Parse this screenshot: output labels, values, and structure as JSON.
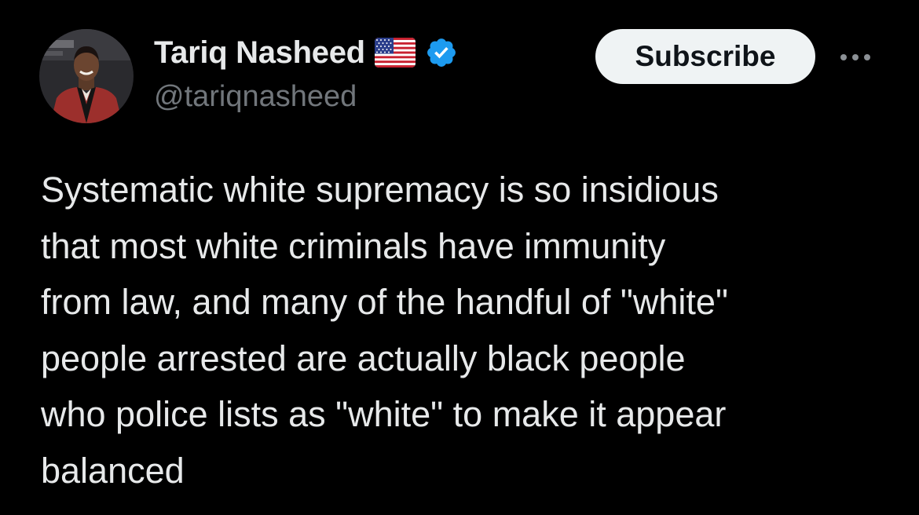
{
  "author": {
    "display_name": "Tariq Nasheed",
    "handle": "@tariqnasheed",
    "flag_icon": "us-flag-icon",
    "verified_icon": "verified-badge-icon",
    "verified_color": "#1d9bf0",
    "avatar_icon": "profile-photo-avatar"
  },
  "actions": {
    "subscribe_label": "Subscribe",
    "more_icon": "more-options-icon"
  },
  "post": {
    "text": "Systematic white supremacy is so insidious\nthat most white criminals have immunity\nfrom law, and many of the handful of \"white\"\npeople arrested are actually black people\nwho police lists as \"white\" to make it appear\nbalanced"
  },
  "colors": {
    "background": "#000000",
    "primary_text": "#e7e9ea",
    "secondary_text": "#71767b",
    "button_bg": "#eff3f4",
    "button_text": "#0f1419"
  }
}
